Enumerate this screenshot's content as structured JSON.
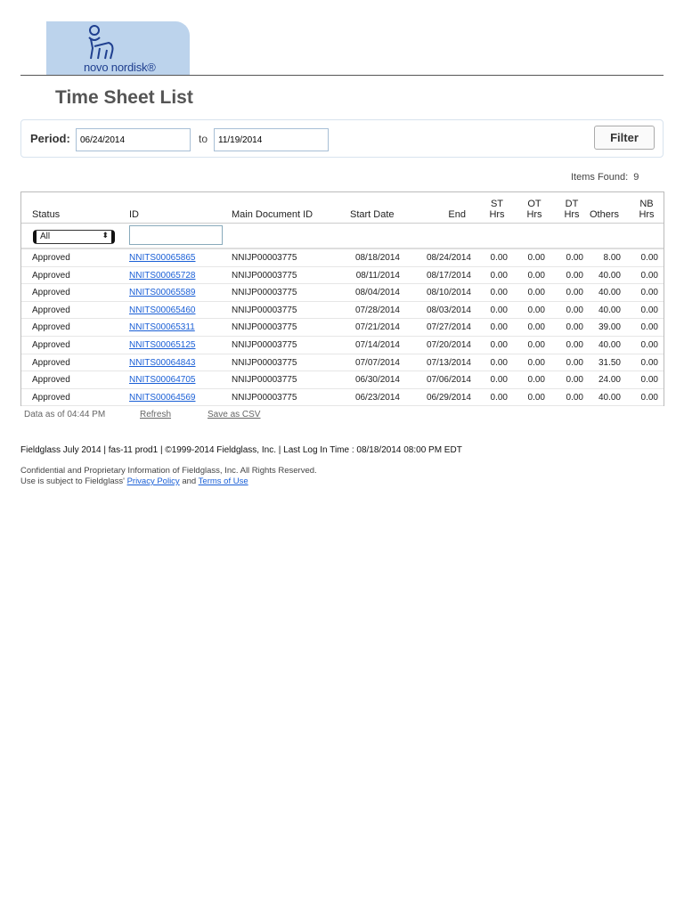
{
  "brand": {
    "logo_text": "novo nordisk®"
  },
  "page": {
    "title": "Time Sheet List"
  },
  "period": {
    "label": "Period:",
    "from": "06/24/2014",
    "to_label": "to",
    "to": "11/19/2014",
    "filter_label": "Filter"
  },
  "items_found": {
    "label": "Items Found:",
    "count": "9"
  },
  "table": {
    "headers": {
      "status": "Status",
      "id": "ID",
      "main": "Main Document ID",
      "start": "Start Date",
      "end": "End",
      "st1": "ST",
      "st2": "Hrs",
      "ot1": "OT",
      "ot2": "Hrs",
      "dt1": "DT",
      "dt2": "Hrs",
      "others": "Others",
      "nb1": "NB",
      "nb2": "Hrs"
    },
    "status_filter": "All",
    "rows": [
      [
        "Approved",
        "NNITS00065865",
        "NNIJP00003775",
        "08/18/2014",
        "08/24/2014",
        "0.00",
        "0.00",
        "0.00",
        "8.00",
        "0.00"
      ],
      [
        "Approved",
        "NNITS00065728",
        "NNIJP00003775",
        "08/11/2014",
        "08/17/2014",
        "0.00",
        "0.00",
        "0.00",
        "40.00",
        "0.00"
      ],
      [
        "Approved",
        "NNITS00065589",
        "NNIJP00003775",
        "08/04/2014",
        "08/10/2014",
        "0.00",
        "0.00",
        "0.00",
        "40.00",
        "0.00"
      ],
      [
        "Approved",
        "NNITS00065460",
        "NNIJP00003775",
        "07/28/2014",
        "08/03/2014",
        "0.00",
        "0.00",
        "0.00",
        "40.00",
        "0.00"
      ],
      [
        "Approved",
        "NNITS00065311",
        "NNIJP00003775",
        "07/21/2014",
        "07/27/2014",
        "0.00",
        "0.00",
        "0.00",
        "39.00",
        "0.00"
      ],
      [
        "Approved",
        "NNITS00065125",
        "NNIJP00003775",
        "07/14/2014",
        "07/20/2014",
        "0.00",
        "0.00",
        "0.00",
        "40.00",
        "0.00"
      ],
      [
        "Approved",
        "NNITS00064843",
        "NNIJP00003775",
        "07/07/2014",
        "07/13/2014",
        "0.00",
        "0.00",
        "0.00",
        "31.50",
        "0.00"
      ],
      [
        "Approved",
        "NNITS00064705",
        "NNIJP00003775",
        "06/30/2014",
        "07/06/2014",
        "0.00",
        "0.00",
        "0.00",
        "24.00",
        "0.00"
      ],
      [
        "Approved",
        "NNITS00064569",
        "NNIJP00003775",
        "06/23/2014",
        "06/29/2014",
        "0.00",
        "0.00",
        "0.00",
        "40.00",
        "0.00"
      ]
    ]
  },
  "meta": {
    "data_as_of": "Data as of 04:44 PM",
    "refresh": "Refresh",
    "save_csv": "Save as CSV"
  },
  "footer": {
    "line1": "Fieldglass July 2014 | fas-11 prod1 | ©1999-2014 Fieldglass, Inc. | Last Log In Time : 08/18/2014 08:00 PM EDT",
    "line2": "Confidential and Proprietary Information of Fieldglass, Inc. All Rights Reserved.",
    "line3_pre": "Use is subject to Fieldglass' ",
    "privacy": "Privacy Policy",
    "and": " and ",
    "terms": "Terms of Use"
  }
}
